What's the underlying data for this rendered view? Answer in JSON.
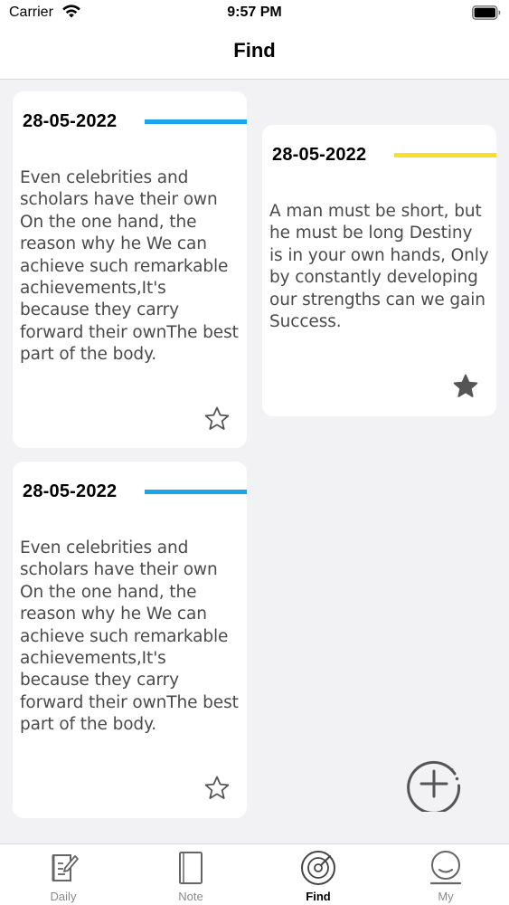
{
  "status_bar": {
    "carrier": "Carrier",
    "time": "9:57 PM"
  },
  "nav": {
    "title": "Find"
  },
  "cards": [
    {
      "date": "28-05-2022",
      "accent_color": "#1aa6e8",
      "body": "Even celebrities and scholars have their own On the one hand, the reason why he We can achieve such remarkable achievements,It's because they carry forward their ownThe best part of the body.",
      "starred": false,
      "star_icon": "star-outline-icon"
    },
    {
      "date": "28-05-2022",
      "accent_color": "#f7e02a",
      "body": "A man must be short, but he must be long Destiny is in your own hands, Only by constantly developing our strengths can we gain Success.",
      "starred": true,
      "star_icon": "star-filled-icon"
    },
    {
      "date": "28-05-2022",
      "accent_color": "#1aa6e8",
      "body": "Even celebrities and scholars have their own On the one hand, the reason why he We can achieve such remarkable achievements,It's because they carry forward their ownThe best part of the body.",
      "starred": false,
      "star_icon": "star-outline-icon"
    }
  ],
  "fab": {
    "icon": "add-circle-icon"
  },
  "tabs": [
    {
      "label": "Daily",
      "icon": "daily-edit-icon",
      "active": false
    },
    {
      "label": "Note",
      "icon": "note-book-icon",
      "active": false
    },
    {
      "label": "Find",
      "icon": "find-radar-icon",
      "active": true
    },
    {
      "label": "My",
      "icon": "my-profile-icon",
      "active": false
    }
  ]
}
